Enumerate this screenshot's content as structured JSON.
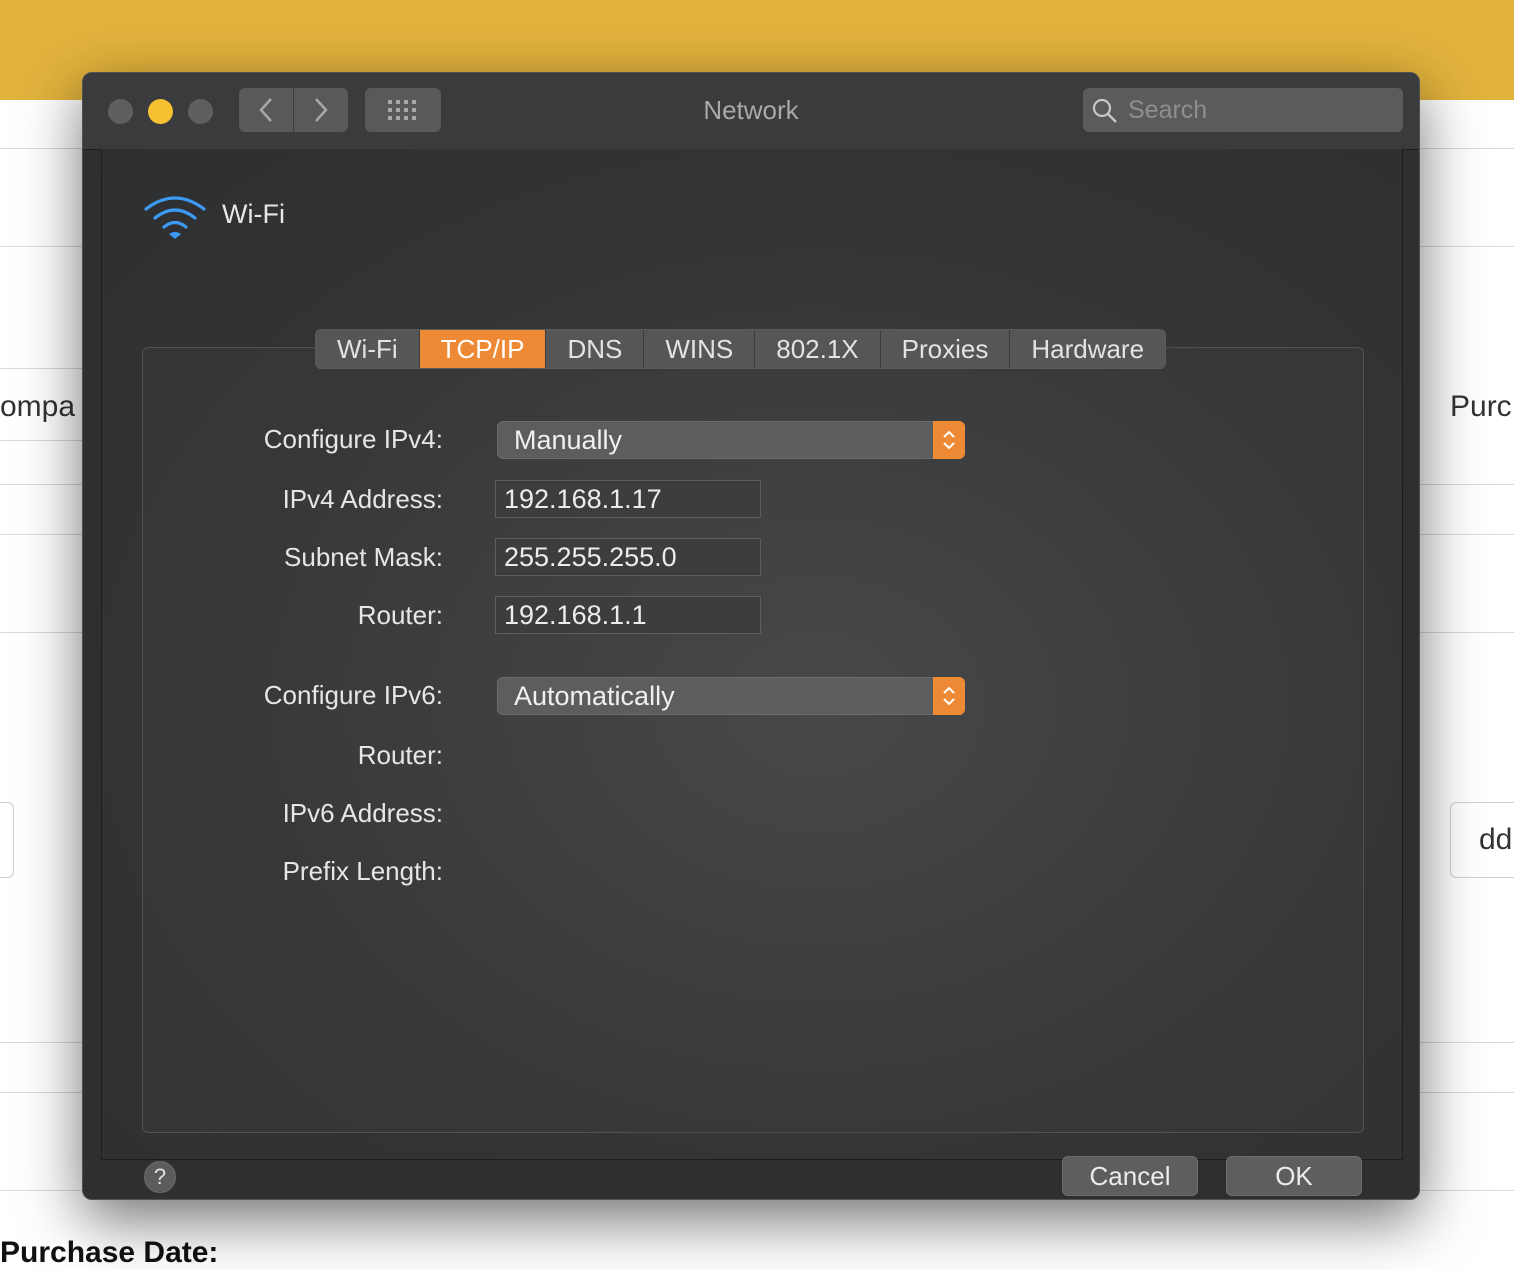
{
  "background": {
    "left_fragment": "ompa",
    "right_fragment": "Purc",
    "right_input_fragment": "dd",
    "bottom_label": "Purchase Date:"
  },
  "window": {
    "title": "Network",
    "search_placeholder": "Search"
  },
  "interface": {
    "name": "Wi-Fi"
  },
  "tabs": [
    {
      "label": "Wi-Fi",
      "active": false
    },
    {
      "label": "TCP/IP",
      "active": true
    },
    {
      "label": "DNS",
      "active": false
    },
    {
      "label": "WINS",
      "active": false
    },
    {
      "label": "802.1X",
      "active": false
    },
    {
      "label": "Proxies",
      "active": false
    },
    {
      "label": "Hardware",
      "active": false
    }
  ],
  "ipv4": {
    "configure_label": "Configure IPv4:",
    "configure_value": "Manually",
    "address_label": "IPv4 Address:",
    "address_value": "192.168.1.17",
    "subnet_label": "Subnet Mask:",
    "subnet_value": "255.255.255.0",
    "router_label": "Router:",
    "router_value": "192.168.1.1"
  },
  "ipv6": {
    "configure_label": "Configure IPv6:",
    "configure_value": "Automatically",
    "router_label": "Router:",
    "address_label": "IPv6 Address:",
    "prefix_label": "Prefix Length:"
  },
  "footer": {
    "help_label": "?",
    "cancel_label": "Cancel",
    "ok_label": "OK"
  },
  "colors": {
    "accent": "#ee8a35",
    "background_bar": "#e1b23c",
    "wifi_icon": "#3b9bf4"
  }
}
